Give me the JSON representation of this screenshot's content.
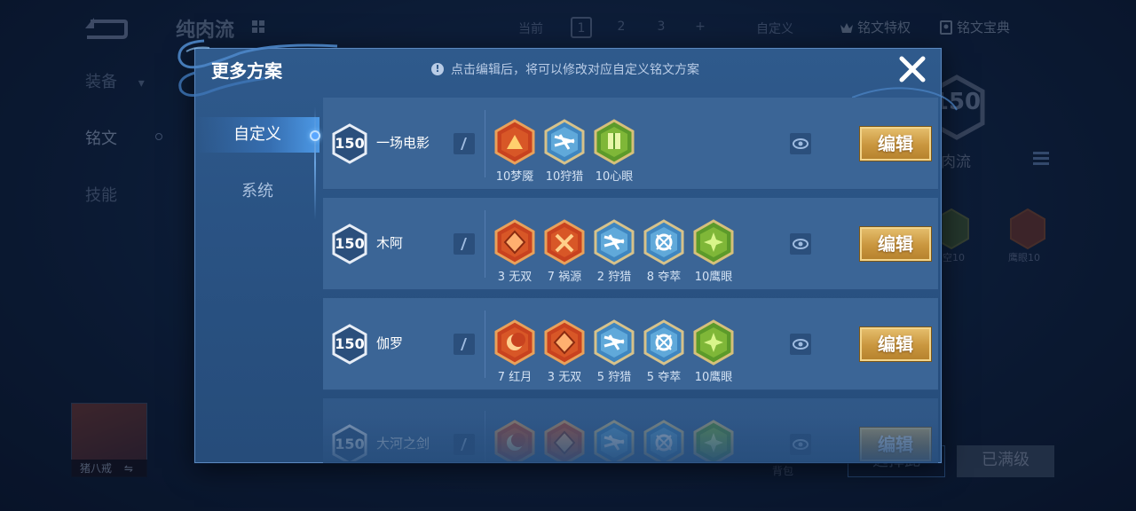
{
  "background": {
    "title": "纯肉流",
    "tabs": {
      "current": "当前",
      "page1": "1",
      "page2": "2",
      "page3": "3",
      "add": "+",
      "custom": "自定义"
    },
    "side_menu": {
      "equipment": "装备",
      "rune": "铭文",
      "skill": "技能"
    },
    "top_right": {
      "rune_privilege": "铭文特权",
      "rune_guide": "铭文宝典"
    },
    "level": "150",
    "plan_label": "肉流",
    "rune_labels": [
      "空10",
      "鹰眼10"
    ],
    "hero_name": "猪八戒",
    "bag_label": "背包",
    "select_button": "选择此",
    "full_level_button": "已满级"
  },
  "modal": {
    "title": "更多方案",
    "hint": "点击编辑后，将可以修改对应自定义铭文方案",
    "tabs": {
      "custom": "自定义",
      "system": "系统"
    },
    "edit_label": "编辑",
    "plans": [
      {
        "level": "150",
        "name": "一场电影",
        "runes": [
          {
            "icon": "dream-demon-rune-icon",
            "label": "10梦魇",
            "color": "red"
          },
          {
            "icon": "hunter-rune-icon",
            "label": "10狩猎",
            "color": "blue"
          },
          {
            "icon": "heart-eye-rune-icon",
            "label": "10心眼",
            "color": "green"
          }
        ]
      },
      {
        "level": "150",
        "name": "木阿",
        "runes": [
          {
            "icon": "unrivaled-rune-icon",
            "label": "3 无双",
            "color": "red"
          },
          {
            "icon": "calamity-rune-icon",
            "label": "7 祸源",
            "color": "red"
          },
          {
            "icon": "hunter-rune-icon",
            "label": "2 狩猎",
            "color": "blue"
          },
          {
            "icon": "plunder-rune-icon",
            "label": "8 夺萃",
            "color": "blue"
          },
          {
            "icon": "eagle-eye-rune-icon",
            "label": "10鹰眼",
            "color": "green"
          }
        ]
      },
      {
        "level": "150",
        "name": "伽罗",
        "runes": [
          {
            "icon": "red-moon-rune-icon",
            "label": "7 红月",
            "color": "red"
          },
          {
            "icon": "unrivaled-rune-icon",
            "label": "3 无双",
            "color": "red"
          },
          {
            "icon": "hunter-rune-icon",
            "label": "5 狩猎",
            "color": "blue"
          },
          {
            "icon": "plunder-rune-icon",
            "label": "5 夺萃",
            "color": "blue"
          },
          {
            "icon": "eagle-eye-rune-icon",
            "label": "10鹰眼",
            "color": "green"
          }
        ]
      },
      {
        "level": "150",
        "name": "大河之剑",
        "runes": [
          {
            "icon": "red-moon-rune-icon",
            "label": "",
            "color": "red"
          },
          {
            "icon": "unrivaled-rune-icon",
            "label": "",
            "color": "red"
          },
          {
            "icon": "hunter-rune-icon",
            "label": "",
            "color": "blue"
          },
          {
            "icon": "plunder-rune-icon",
            "label": "",
            "color": "blue"
          },
          {
            "icon": "eagle-eye-rune-icon",
            "label": "",
            "color": "green"
          }
        ]
      }
    ]
  },
  "colors": {
    "red_rune": "#d2502a",
    "blue_rune": "#5fa8d8",
    "green_rune": "#7fb23a",
    "edit_button": "#d8a852",
    "panel": "#2a5384"
  }
}
